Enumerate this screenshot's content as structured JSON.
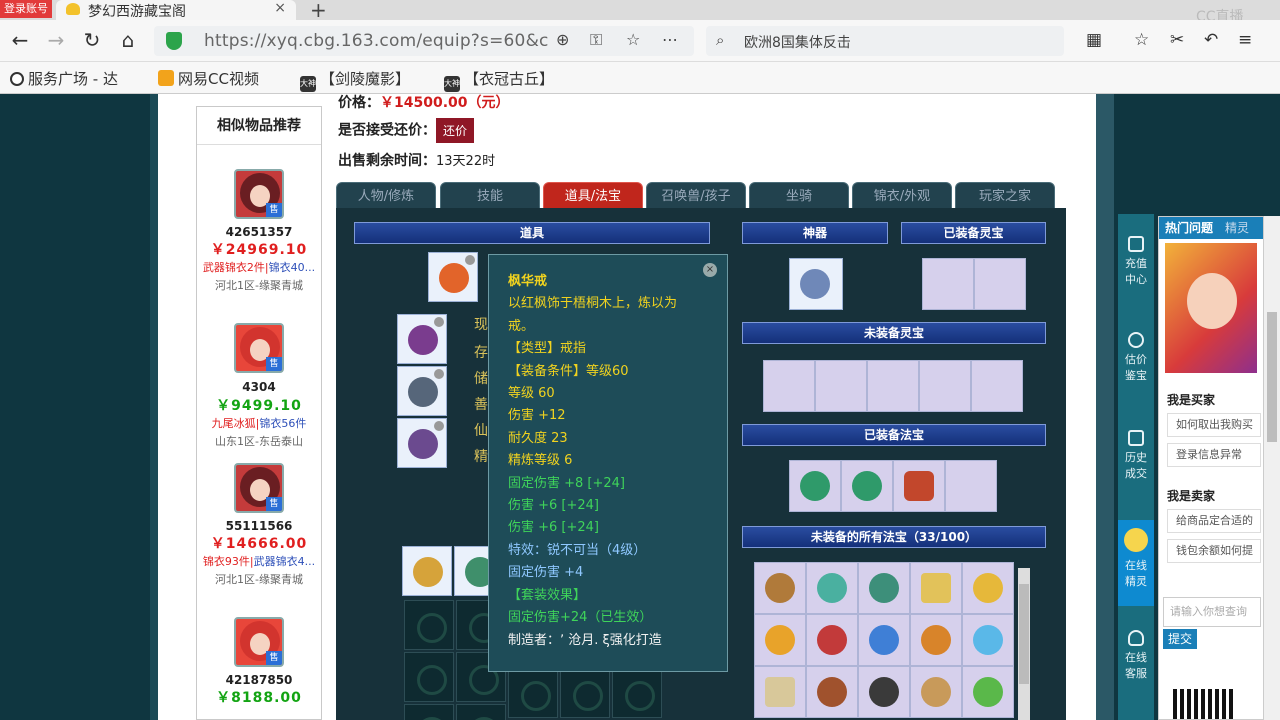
{
  "browser": {
    "login_badge": "登录账号",
    "tab_title": "梦幻西游藏宝阁",
    "tab_close": "×",
    "new_tab": "+",
    "watermark": "CC直播",
    "url": "https://xyq.cbg.163.com/equip?s=60&c",
    "search_text": "欧洲8国集体反击",
    "bookmarks": [
      {
        "label": "服务广场 - 达",
        "icon": "globe-icon"
      },
      {
        "label": "网易CC视频",
        "icon": "cc-icon"
      },
      {
        "label": "【剑陵魔影】",
        "icon": "dashen-icon"
      },
      {
        "label": "【衣冠古丘】",
        "icon": "dashen-icon"
      }
    ],
    "bookmark_icon_text": "大神"
  },
  "recommend": {
    "title": "相似物品推荐",
    "sell_tag": "售",
    "items": [
      {
        "id": "42651357",
        "price": "￥24969.10",
        "price_color": "red",
        "tag_a": "武器锦衣2件",
        "tag_b": "锦衣40...",
        "server": "河北1区-缘聚青城"
      },
      {
        "id": "4304",
        "price": "￥9499.10",
        "price_color": "green",
        "tag_a": "九尾冰狐",
        "tag_b": "锦衣56件",
        "server": "山东1区-东岳泰山"
      },
      {
        "id": "55111566",
        "price": "￥14666.00",
        "price_color": "red",
        "tag_a": "锦衣93件",
        "tag_b": "武器锦衣4...",
        "server": "河北1区-缘聚青城"
      },
      {
        "id": "42187850",
        "price": "￥8188.00",
        "price_color": "green",
        "tag_a": "",
        "tag_b": "",
        "server": ""
      }
    ]
  },
  "info": {
    "price_label": "价格：",
    "price_value": "￥14500.00（元）",
    "bargain_label": "是否接受还价：",
    "bargain_button": "还价",
    "time_label": "出售剩余时间：",
    "time_value": "13天22时"
  },
  "tabs": [
    "人物/修炼",
    "技能",
    "道具/法宝",
    "召唤兽/孩子",
    "坐骑",
    "锦衣/外观",
    "玩家之家"
  ],
  "active_tab": 2,
  "panel": {
    "items_header": "道具",
    "artifact_header": "神器",
    "equipped_spirit_header": "已装备灵宝",
    "unequipped_spirit_header": "未装备灵宝",
    "equipped_magic_header": "已装备法宝",
    "all_magic_header": "未装备的所有法宝（33/100）",
    "side_chars": [
      "现",
      "存",
      "储",
      "善",
      "仙",
      "精"
    ]
  },
  "tooltip": {
    "name": "枫华戒",
    "desc_1": "以红枫饰于梧桐木上，炼以为",
    "desc_2": "戒。",
    "type": "【类型】戒指",
    "requirement": "【装备条件】等级60",
    "level": "等级 60",
    "damage": "伤害 +12",
    "durability": "耐久度 23",
    "refine": "精炼等级 6",
    "fixed_damage_1": "固定伤害 +8 [+24]",
    "damage_2": "伤害 +6 [+24]",
    "damage_3": "伤害 +6 [+24]",
    "special": "特效：锐不可当（4级）",
    "fixed_damage_2": "固定伤害 +4",
    "set_effect": "【套装效果】",
    "set_value": "固定伤害+24（已生效）",
    "maker": "制造者：ʼ 沧月. ξ强化打造"
  },
  "right_bar": {
    "items": [
      {
        "label_1": "充值",
        "label_2": "中心"
      },
      {
        "label_1": "估价",
        "label_2": "鉴宝"
      },
      {
        "label_1": "历史",
        "label_2": "成交"
      },
      {
        "label_1": "在线",
        "label_2": "精灵"
      },
      {
        "label_1": "在线",
        "label_2": "客服"
      }
    ]
  },
  "help": {
    "tab_hot": "热门问题",
    "tab_other": "精灵",
    "buyer_title": "我是买家",
    "buyer_q1": "如何取出我购买",
    "buyer_q2": "登录信息异常",
    "seller_title": "我是卖家",
    "seller_q1": "给商品定合适的",
    "seller_q2": "钱包余额如何提",
    "input_placeholder": "请输入你想查询",
    "submit": "提交"
  },
  "colors": {
    "page_bg": "#0f3640",
    "active_tab": "#c0261c",
    "price_red": "#e01f1f",
    "price_green": "#13a413",
    "tooltip_bg": "#1e4c58"
  }
}
